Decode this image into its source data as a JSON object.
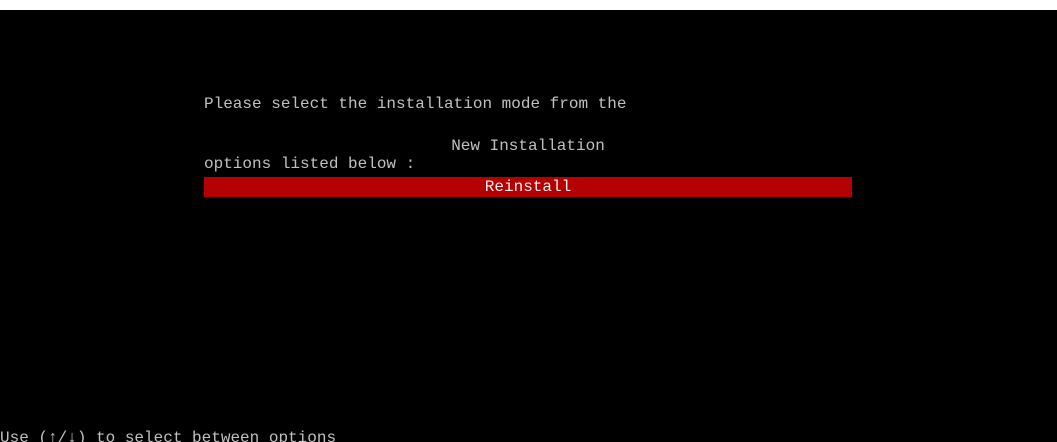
{
  "prompt": {
    "line1": "Please select the installation mode from the",
    "line2": "options listed below :"
  },
  "options": [
    {
      "label": "New Installation",
      "selected": false
    },
    {
      "label": "Reinstall",
      "selected": true
    }
  ],
  "footer": {
    "hint": "Use (↑/↓) to select between options"
  },
  "colors": {
    "background": "#000000",
    "text": "#c0c0c0",
    "highlight": "#b40000"
  }
}
